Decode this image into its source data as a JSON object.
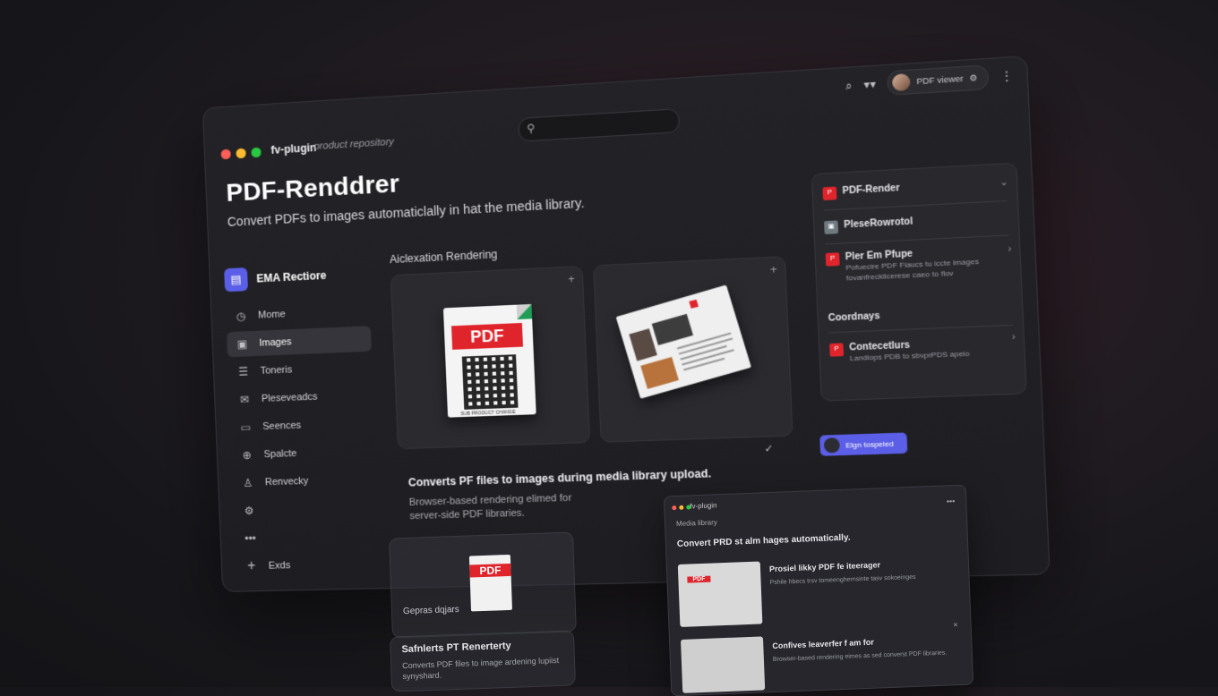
{
  "window": {
    "app_name": "fv-plugin",
    "app_sub": "product repository",
    "title": "PDF-Renddrer",
    "subtitle": "Convert PDFs to images automaticlally in hat the media library."
  },
  "colors": {
    "accent": "#5b5ee6",
    "pdf_red": "#e0242b",
    "dot_red": "#ff5f57",
    "dot_yellow": "#febc2e",
    "dot_green": "#28c840"
  },
  "header": {
    "user_label": "PDF viewer"
  },
  "sidebar": {
    "brand": "EMA Rectiore",
    "items": [
      {
        "label": "Mome",
        "icon": "clock-icon"
      },
      {
        "label": "Images",
        "icon": "image-icon"
      },
      {
        "label": "Toneris",
        "icon": "list-icon"
      },
      {
        "label": "Pleseveadcs",
        "icon": "mail-icon"
      },
      {
        "label": "Seences",
        "icon": "doc-icon"
      },
      {
        "label": "Spalcte",
        "icon": "plus-circle-icon"
      },
      {
        "label": "Renvecky",
        "icon": "user-icon"
      },
      {
        "label": "",
        "icon": "gear-icon"
      },
      {
        "label": "",
        "icon": "more-icon"
      },
      {
        "label": "Exds",
        "icon": "plus-icon"
      }
    ]
  },
  "main": {
    "section": "Aiclexation Rendering",
    "pdf_badge": "PDF",
    "qr_caption": "SUB PRODUCT CHANGE",
    "caption_title": "Converts PF files to images during media library upload.",
    "caption_desc": "Browser-based rendering elimed for server-side PDF libraries."
  },
  "right_panel": {
    "items": [
      {
        "title": "PDF-Render",
        "desc": ""
      },
      {
        "title": "PleseRowrotol",
        "desc": ""
      },
      {
        "title": "Pler Em Pfupe",
        "desc": "Pofuecire PDF Fiaucs tu iccte images fovanfrecklicerese caeo to flov"
      },
      {
        "title": "Coordnays",
        "desc": ""
      },
      {
        "title": "Contecetlurs",
        "desc": "Landiops PDB to sbvprPDS apeio"
      }
    ]
  },
  "cta": {
    "label": "Elgn tospeled"
  },
  "lower": {
    "left_title": "Gepras dqjars",
    "left_card_title": "Safnlerts PT Renerterty",
    "left_card_desc": "Converts PDF files to image ardening lupiist synyshard.",
    "mini_app": "fv-plugin",
    "mini_crumb": "Media library",
    "mini_title": "Convert PRD st alm hages automatically.",
    "mini_item1_title": "Prosiel likky PDF fe iteerager",
    "mini_item1_desc": "Pshile hbecs trsv tomeenghernsinte tasv sokoeinges",
    "mini_item2_title": "Confives leaverfer f am for",
    "mini_item2_desc": "Browser-based rendering eimes as sed converst PDF libraries."
  }
}
